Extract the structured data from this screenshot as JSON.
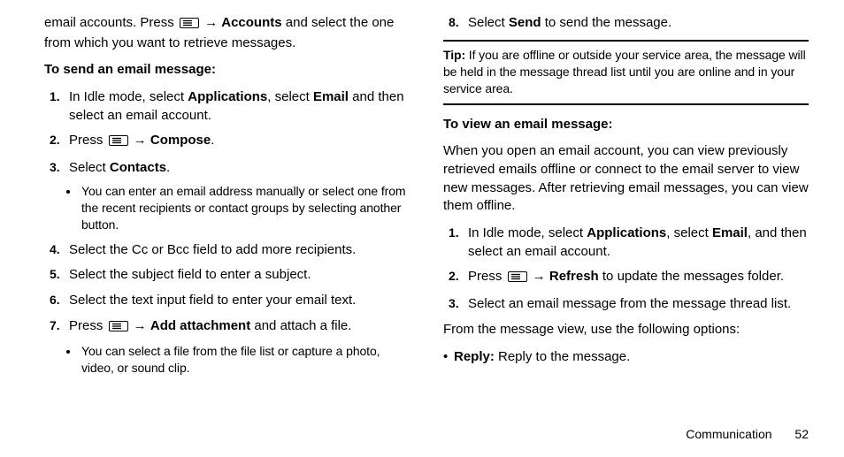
{
  "left": {
    "intro_run": [
      "email accounts. Press ",
      "ICON",
      " → ",
      "Accounts",
      " and select the one from which you want to retrieve messages."
    ],
    "subhead": "To send an email message:",
    "steps": [
      {
        "num": "1.",
        "runs": [
          "In Idle mode, select ",
          "Applications",
          ", select ",
          "Email",
          " and then select an email account."
        ]
      },
      {
        "num": "2.",
        "runs": [
          "Press ",
          "ICON",
          " → ",
          "Compose",
          "."
        ]
      },
      {
        "num": "3.",
        "runs": [
          "Select ",
          "Contacts",
          "."
        ],
        "sub": [
          "You can enter an email address manually or select one from the recent recipients or contact groups by selecting another button."
        ]
      },
      {
        "num": "4.",
        "runs": [
          "Select the Cc or Bcc field to add more recipients."
        ]
      },
      {
        "num": "5.",
        "runs": [
          "Select the subject field to enter a subject."
        ]
      },
      {
        "num": "6.",
        "runs": [
          "Select the text input field to enter your email text."
        ]
      },
      {
        "num": "7.",
        "runs": [
          "Press ",
          "ICON",
          " → ",
          "Add attachment",
          " and attach a file."
        ],
        "sub": [
          "You can select a file from the file list or capture a photo, video, or sound clip."
        ]
      }
    ]
  },
  "right": {
    "steps_top": [
      {
        "num": "8.",
        "runs": [
          "Select ",
          "Send",
          " to send the message."
        ]
      }
    ],
    "tip_label": "Tip:",
    "tip_body": " If you are offline or outside your service area, the message will be held in the message thread list until you are online and in your service area.",
    "subhead": "To view an email message:",
    "view_intro": "When you open an email account, you can view previously retrieved emails offline or connect to the email server to view new messages. After retrieving email messages, you can view them offline.",
    "steps_view": [
      {
        "num": "1.",
        "runs": [
          "In Idle mode, select ",
          "Applications",
          ", select ",
          "Email",
          ", and then select an email account."
        ]
      },
      {
        "num": "2.",
        "runs": [
          "Press ",
          "ICON",
          " → ",
          "Refresh",
          " to update the messages folder."
        ]
      },
      {
        "num": "3.",
        "runs": [
          "Select an email message from the message thread list."
        ]
      }
    ],
    "post": "From the message view, use the following options:",
    "bullets": [
      {
        "label": "Reply:",
        "text": " Reply to the message."
      }
    ]
  },
  "footer": {
    "section": "Communication",
    "page": "52"
  },
  "chart_data": null
}
